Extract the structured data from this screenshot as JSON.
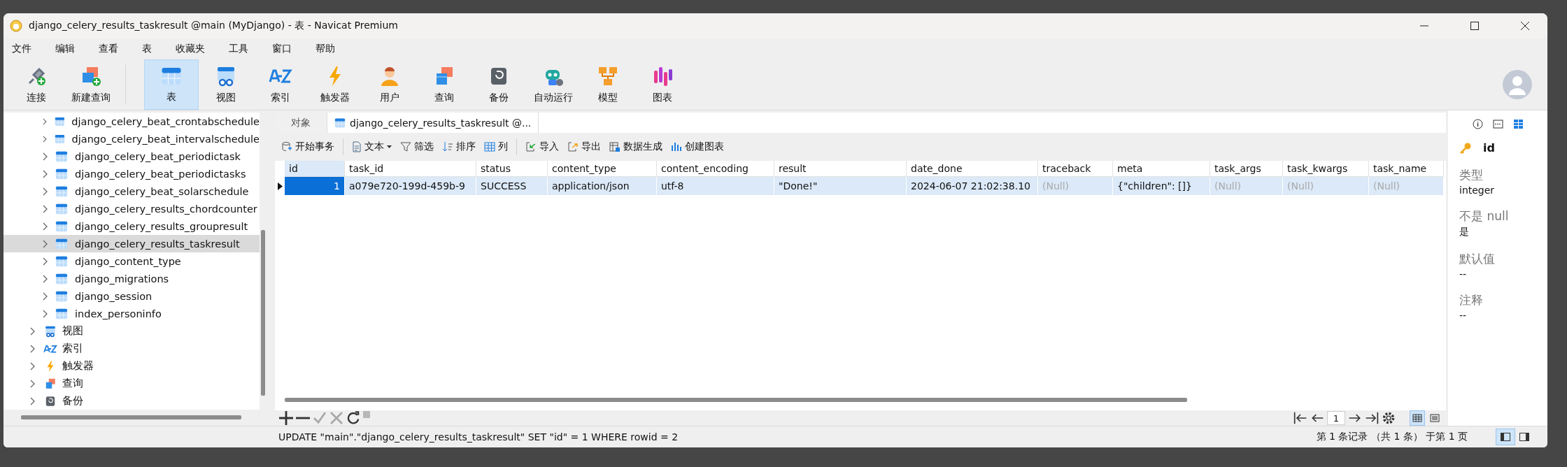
{
  "window": {
    "title": "django_celery_results_taskresult @main (MyDjango) - 表 - Navicat Premium"
  },
  "menu": [
    "文件",
    "编辑",
    "查看",
    "表",
    "收藏夹",
    "工具",
    "窗口",
    "帮助"
  ],
  "toolbar": [
    {
      "label": "连接",
      "selected": false
    },
    {
      "label": "新建查询",
      "selected": false
    },
    {
      "label": "表",
      "selected": true
    },
    {
      "label": "视图",
      "selected": false
    },
    {
      "label": "索引",
      "selected": false
    },
    {
      "label": "触发器",
      "selected": false
    },
    {
      "label": "用户",
      "selected": false
    },
    {
      "label": "查询",
      "selected": false
    },
    {
      "label": "备份",
      "selected": false
    },
    {
      "label": "自动运行",
      "selected": false
    },
    {
      "label": "模型",
      "selected": false
    },
    {
      "label": "图表",
      "selected": false
    }
  ],
  "sidebar": {
    "tables": [
      {
        "label": "django_celery_beat_crontabschedule",
        "selected": false
      },
      {
        "label": "django_celery_beat_intervalschedule",
        "selected": false
      },
      {
        "label": "django_celery_beat_periodictask",
        "selected": false
      },
      {
        "label": "django_celery_beat_periodictasks",
        "selected": false
      },
      {
        "label": "django_celery_beat_solarschedule",
        "selected": false
      },
      {
        "label": "django_celery_results_chordcounter",
        "selected": false
      },
      {
        "label": "django_celery_results_groupresult",
        "selected": false
      },
      {
        "label": "django_celery_results_taskresult",
        "selected": true
      },
      {
        "label": "django_content_type",
        "selected": false
      },
      {
        "label": "django_migrations",
        "selected": false
      },
      {
        "label": "django_session",
        "selected": false
      },
      {
        "label": "index_personinfo",
        "selected": false
      }
    ],
    "categories": [
      {
        "label": "视图"
      },
      {
        "label": "索引"
      },
      {
        "label": "触发器"
      },
      {
        "label": "查询"
      },
      {
        "label": "备份"
      }
    ]
  },
  "tabs": [
    {
      "label": "对象",
      "selected": false
    },
    {
      "label": "django_celery_results_taskresult @...",
      "selected": true
    }
  ],
  "data_toolbar": [
    "开始事务",
    "文本",
    "筛选",
    "排序",
    "列",
    "导入",
    "导出",
    "数据生成",
    "创建图表"
  ],
  "table": {
    "columns": [
      "id",
      "task_id",
      "status",
      "content_type",
      "content_encoding",
      "result",
      "date_done",
      "traceback",
      "meta",
      "task_args",
      "task_kwargs",
      "task_name"
    ],
    "rows": [
      {
        "selected": true,
        "cells": [
          {
            "text": "1",
            "kind": "number",
            "focused": true
          },
          {
            "text": "a079e720-199d-459b-9",
            "kind": "value",
            "focused": false
          },
          {
            "text": "SUCCESS",
            "kind": "value",
            "focused": false
          },
          {
            "text": "application/json",
            "kind": "value",
            "focused": false
          },
          {
            "text": "utf-8",
            "kind": "value",
            "focused": false
          },
          {
            "text": "\"Done!\"",
            "kind": "value",
            "focused": false
          },
          {
            "text": "2024-06-07 21:02:38.10",
            "kind": "value",
            "focused": false
          },
          {
            "text": "(Null)",
            "kind": "null",
            "focused": false
          },
          {
            "text": "{\"children\": []}",
            "kind": "value",
            "focused": false
          },
          {
            "text": "(Null)",
            "kind": "null",
            "focused": false
          },
          {
            "text": "(Null)",
            "kind": "null",
            "focused": false
          },
          {
            "text": "(Null)",
            "kind": "null",
            "focused": false
          }
        ]
      }
    ]
  },
  "pager": {
    "page": "1"
  },
  "field_info": {
    "name": "id",
    "properties": [
      {
        "label": "类型",
        "value": "integer"
      },
      {
        "label": "不是 null",
        "value": "是"
      },
      {
        "label": "默认值",
        "value": "--"
      },
      {
        "label": "注释",
        "value": "--"
      }
    ]
  },
  "status_bar": {
    "sql": "UPDATE \"main\".\"django_celery_results_taskresult\" SET \"id\" = 1 WHERE rowid = 2",
    "records": "第 1 条记录 （共 1 条） 于第 1 页"
  }
}
